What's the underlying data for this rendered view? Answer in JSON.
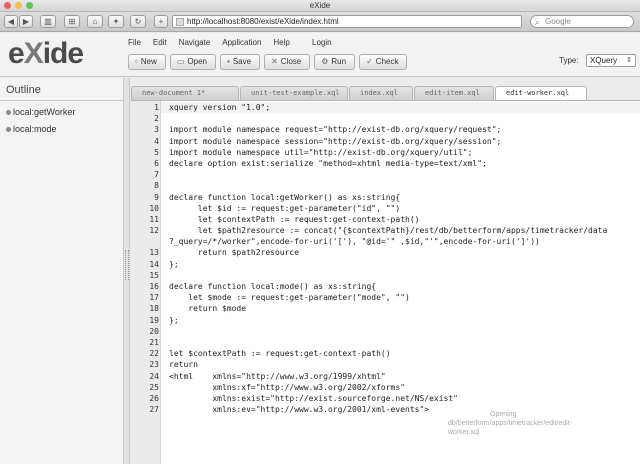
{
  "window": {
    "title": "eXide"
  },
  "browser": {
    "back": "◀",
    "forward": "▶",
    "url": "http://localhost:8080/exist/eXide/index.html",
    "search_placeholder": "Google",
    "add_tab": "+"
  },
  "app": {
    "logo": "eXide",
    "menu": [
      "File",
      "Edit",
      "Navigate",
      "Application",
      "Help"
    ],
    "login": "Login",
    "toolbar": {
      "new": "New",
      "open": "Open",
      "save": "Save",
      "close": "Close",
      "run": "Run",
      "check": "Check"
    },
    "type_label": "Type:",
    "type_value": "XQuery"
  },
  "sidebar": {
    "title": "Outline",
    "items": [
      "local:getWorker",
      "local:mode"
    ]
  },
  "tabs": [
    "new-document 1*",
    "unit-test-example.xql",
    "index.xql",
    "edit-item.xql",
    "edit-worker.xql"
  ],
  "active_tab": 4,
  "editor": {
    "lines": [
      {
        "n": "1",
        "code": "xquery version \"1.0\";"
      },
      {
        "n": "2",
        "code": ""
      },
      {
        "n": "3",
        "code": "import module namespace request=\"http://exist-db.org/xquery/request\";"
      },
      {
        "n": "4",
        "code": "import module namespace session=\"http://exist-db.org/xquery/session\";"
      },
      {
        "n": "5",
        "code": "import module namespace util=\"http://exist-db.org/xquery/util\";"
      },
      {
        "n": "6",
        "code": "declare option exist:serialize \"method=xhtml media-type=text/xml\";"
      },
      {
        "n": "7",
        "code": ""
      },
      {
        "n": "8",
        "code": ""
      },
      {
        "n": "9",
        "code": "declare function local:getWorker() as xs:string{"
      },
      {
        "n": "10",
        "code": "      let $id := request:get-parameter(\"id\", \"\")"
      },
      {
        "n": "11",
        "code": "      let $contextPath := request:get-context-path()"
      },
      {
        "n": "12",
        "code": "      let $path2resource := concat(\"{$contextPath}/rest/db/betterform/apps/timetracker/data"
      },
      {
        "n": "",
        "code": "?_query=/*/worker\",encode-for-uri('['), \"@id='\" ,$id,\"'\",encode-for-uri(']'))"
      },
      {
        "n": "13",
        "code": "      return $path2resource"
      },
      {
        "n": "14",
        "code": "};"
      },
      {
        "n": "15",
        "code": ""
      },
      {
        "n": "16",
        "code": "declare function local:mode() as xs:string{"
      },
      {
        "n": "17",
        "code": "    let $mode := request:get-parameter(\"mode\", \"\")"
      },
      {
        "n": "18",
        "code": "    return $mode"
      },
      {
        "n": "19",
        "code": "};"
      },
      {
        "n": "20",
        "code": ""
      },
      {
        "n": "21",
        "code": ""
      },
      {
        "n": "22",
        "code": "let $contextPath := request:get-context-path()"
      },
      {
        "n": "23",
        "code": "return"
      },
      {
        "n": "24",
        "code": "<html    xmlns=\"http://www.w3.org/1999/xhtml\""
      },
      {
        "n": "25",
        "code": "         xmlns:xf=\"http://www.w3.org/2002/xforms\""
      },
      {
        "n": "26",
        "code": "         xmlns:exist=\"http://exist.sourceforge.net/NS/exist\""
      },
      {
        "n": "27",
        "code": "         xmlns:ev=\"http://www.w3.org/2001/xml-events\">"
      }
    ]
  },
  "status_overlay": {
    "line1": "Opening",
    "line2": "db/betterform/apps/timetracker/edit/edit-",
    "line3": "worker.xql"
  },
  "colors": {
    "close_dot": "#ee5f5b",
    "min_dot": "#f6be4f",
    "max_dot": "#62c655",
    "code_bg": "#ffffff",
    "gutter_bg": "#ebebeb"
  }
}
